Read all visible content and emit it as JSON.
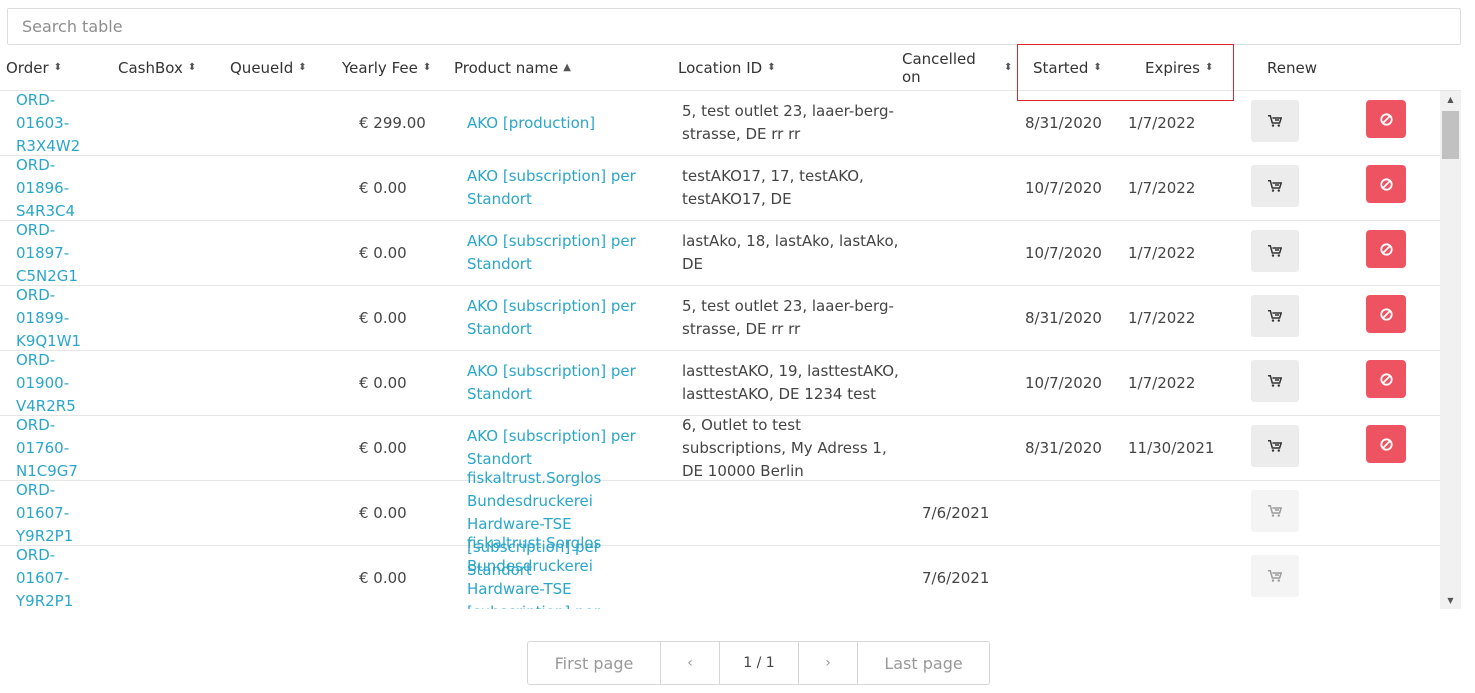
{
  "search": {
    "placeholder": "Search table"
  },
  "columns": {
    "order": "Order",
    "cashbox": "CashBox",
    "queueid": "QueueId",
    "yearly_fee": "Yearly Fee",
    "product_name": "Product name",
    "location_id": "Location ID",
    "cancelled_on": "Cancelled on",
    "started": "Started",
    "expires": "Expires",
    "renew": "Renew"
  },
  "sort_icons": {
    "unsorted": "⬍",
    "ascending": "▲"
  },
  "rows": [
    {
      "order": [
        "ORD-",
        "01603-",
        "R3X4W2"
      ],
      "fee": "€ 299.00",
      "product": "AKO [production]",
      "location": "5, test outlet 23, laaer-berg-strasse, DE rr rr",
      "cancelled": "",
      "started": "8/31/2020",
      "expires": "1/7/2022"
    },
    {
      "order": [
        "ORD-",
        "01896-",
        "S4R3C4"
      ],
      "fee": "€ 0.00",
      "product": "AKO [subscription] per Standort",
      "location": "testAKO17, 17, testAKO, testAKO17, DE",
      "cancelled": "",
      "started": "10/7/2020",
      "expires": "1/7/2022"
    },
    {
      "order": [
        "ORD-",
        "01897-",
        "C5N2G1"
      ],
      "fee": "€ 0.00",
      "product": "AKO [subscription] per Standort",
      "location": "lastAko, 18, lastAko, lastAko, DE",
      "cancelled": "",
      "started": "10/7/2020",
      "expires": "1/7/2022"
    },
    {
      "order": [
        "ORD-",
        "01899-",
        "K9Q1W1"
      ],
      "fee": "€ 0.00",
      "product": "AKO [subscription] per Standort",
      "location": "5, test outlet 23, laaer-berg-strasse, DE rr rr",
      "cancelled": "",
      "started": "8/31/2020",
      "expires": "1/7/2022"
    },
    {
      "order": [
        "ORD-",
        "01900-",
        "V4R2R5"
      ],
      "fee": "€ 0.00",
      "product": "AKO [subscription] per Standort",
      "location": "lasttestAKO, 19, lasttestAKO, lasttestAKO, DE 1234 test",
      "cancelled": "",
      "started": "10/7/2020",
      "expires": "1/7/2022"
    },
    {
      "order": [
        "ORD-",
        "01760-",
        "N1C9G7"
      ],
      "fee": "€ 0.00",
      "product": "AKO [subscription] per Standort",
      "location": "6, Outlet to test subscriptions, My Adress 1, DE 10000 Berlin",
      "cancelled": "",
      "started": "8/31/2020",
      "expires": "11/30/2021"
    },
    {
      "order": [
        "ORD-",
        "01607-",
        "Y9R2P1"
      ],
      "fee": "€ 0.00",
      "product": "fiskaltrust.Sorglos Bundesdruckerei Hardware-TSE [subscription] per Standort",
      "location": "",
      "cancelled": "7/6/2021",
      "started": "",
      "expires": ""
    },
    {
      "order": [
        "ORD-",
        "01607-",
        "Y9R2P1"
      ],
      "fee": "€ 0.00",
      "product": "fiskaltrust.Sorglos Bundesdruckerei Hardware-TSE [subscription] per Standort",
      "location": "",
      "cancelled": "7/6/2021",
      "started": "",
      "expires": ""
    }
  ],
  "icons": {
    "renew": "cart-icon",
    "cancel": "ban-icon"
  },
  "colors": {
    "link": "#2aa6c9",
    "cancel_button": "#ee5361",
    "highlight_box": "#e0262c"
  },
  "pager": {
    "first": "First page",
    "prev": "‹",
    "current": "1 / 1",
    "next": "›",
    "last": "Last page"
  },
  "scroll": {
    "up": "▲",
    "down": "▼"
  }
}
